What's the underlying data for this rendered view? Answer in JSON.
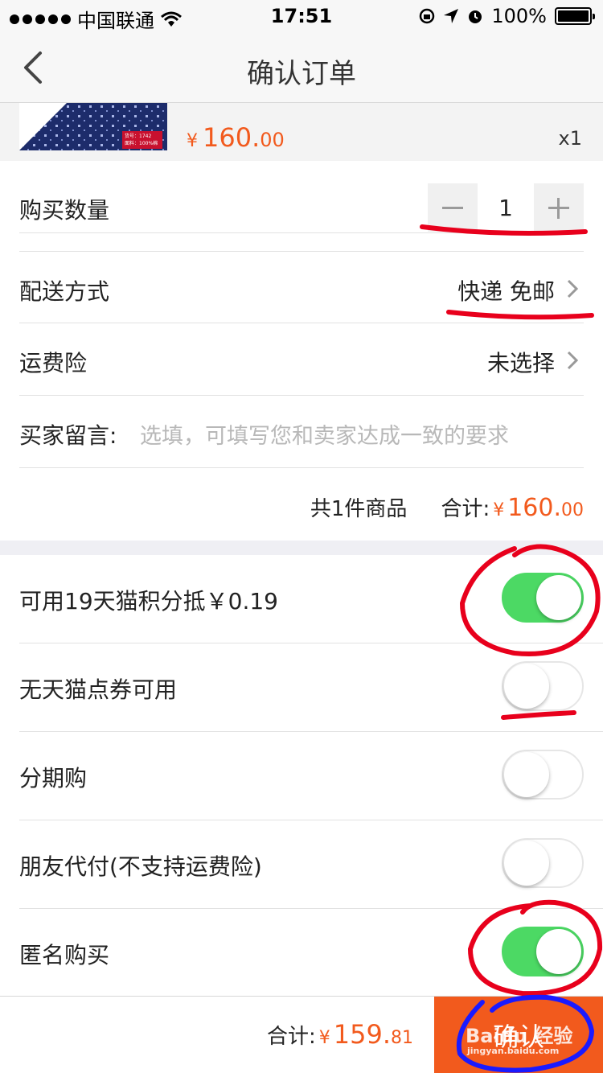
{
  "status_bar": {
    "carrier": "中国联通",
    "time": "17:51",
    "battery": "100%"
  },
  "nav": {
    "title": "确认订单"
  },
  "product": {
    "thumb_tag_line1": "货号：1742",
    "thumb_tag_line2": "面料：100%棉",
    "price_yen": "¥",
    "price_int": "160.",
    "price_cents": "00",
    "quantity_tag": "x1"
  },
  "order": {
    "quantity_label": "购买数量",
    "quantity_value": "1",
    "shipping_label": "配送方式",
    "shipping_value": "快递 免邮",
    "insurance_label": "运费险",
    "insurance_value": "未选择",
    "message_label": "买家留言:",
    "message_placeholder": "选填，可填写您和卖家达成一致的要求",
    "items_count": "共1件商品",
    "subtotal_label": "合计:",
    "subtotal_yen": "¥",
    "subtotal_int": "160.",
    "subtotal_cents": "00"
  },
  "options": [
    {
      "label": "可用19天猫积分抵￥0.19",
      "on": true
    },
    {
      "label": "无天猫点券可用",
      "on": false
    },
    {
      "label": "分期购",
      "on": false
    },
    {
      "label": "朋友代付(不支持运费险)",
      "on": false
    },
    {
      "label": "匿名购买",
      "on": true
    }
  ],
  "footer": {
    "total_label": "合计:",
    "total_yen": "¥",
    "total_int": "159.",
    "total_cents": "81",
    "confirm_label": "确认"
  },
  "watermark": {
    "brand": "Baidu 经验",
    "url": "jingyan.baidu.com"
  },
  "colors": {
    "accent_orange": "#f25a1d",
    "switch_on": "#4cd964",
    "annotation_red": "#e8001c",
    "annotation_blue": "#1a1aff"
  }
}
